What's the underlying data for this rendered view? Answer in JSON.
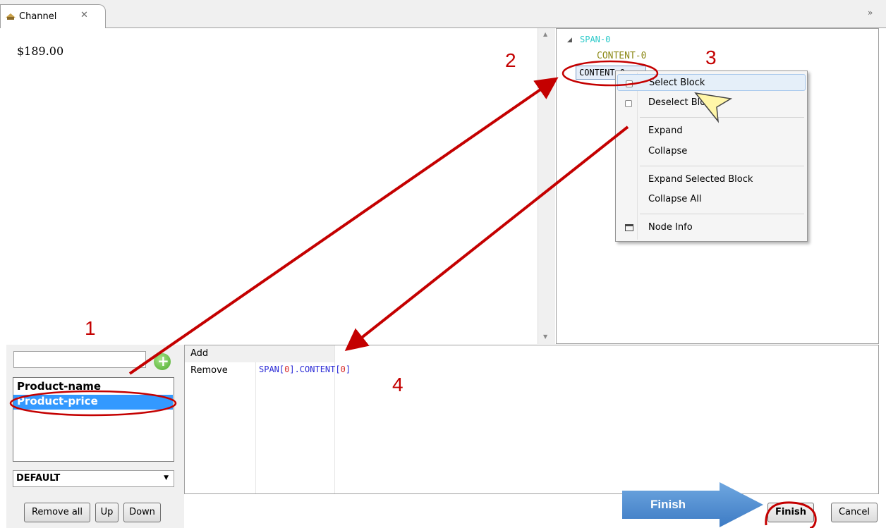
{
  "tab": {
    "title": "Channel",
    "close_glyph": "✕",
    "chevron": "»"
  },
  "preview": {
    "price": "$189.00"
  },
  "tree": {
    "nodes": [
      "SPAN-0",
      "CONTENT-0",
      "CONTENT-0"
    ],
    "colors": {
      "span": "#29c9c9",
      "content": "#8d8a18"
    }
  },
  "context_menu": {
    "items": [
      "Select Block",
      "Deselect Block",
      "Expand",
      "Collapse",
      "Expand Selected Block",
      "Collapse All",
      "Node Info"
    ]
  },
  "left_panel": {
    "input_value": "",
    "list_items": [
      "Product-name",
      "Product-price"
    ],
    "selected_item": "Product-price",
    "select_value": "DEFAULT",
    "buttons": {
      "remove_all": "Remove all",
      "up": "Up",
      "down": "Down"
    }
  },
  "actions_panel": {
    "add_label": "Add",
    "remove_label": "Remove",
    "xpath_parts": {
      "span": "SPAN[",
      "span_idx": "0",
      "content": "].CONTENT[",
      "content_idx": "0",
      "close": "]"
    }
  },
  "annotations": {
    "n1": "1",
    "n2": "2",
    "n3": "3",
    "n4": "4",
    "finish_callout": "Finish",
    "color": "#c40000"
  },
  "footer": {
    "finish": "Finish",
    "cancel": "Cancel"
  }
}
